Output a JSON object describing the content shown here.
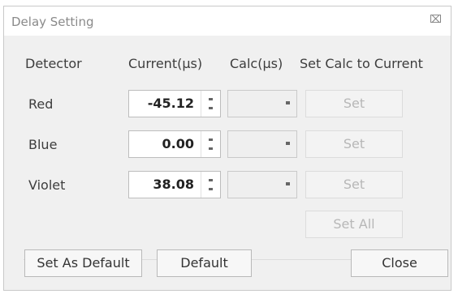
{
  "window": {
    "title": "Delay Setting",
    "close_icon": "close-icon"
  },
  "headers": {
    "detector": "Detector",
    "current": "Current(μs)",
    "calc": "Calc(μs)",
    "set_calc": "Set Calc to Current"
  },
  "rows": [
    {
      "label": "Red",
      "current": "-45.12",
      "set_label": "Set"
    },
    {
      "label": "Blue",
      "current": "0.00",
      "set_label": "Set"
    },
    {
      "label": "Violet",
      "current": "38.08",
      "set_label": "Set"
    }
  ],
  "set_all_label": "Set All",
  "buttons": {
    "set_as_default": "Set As Default",
    "default": "Default",
    "close": "Close"
  }
}
